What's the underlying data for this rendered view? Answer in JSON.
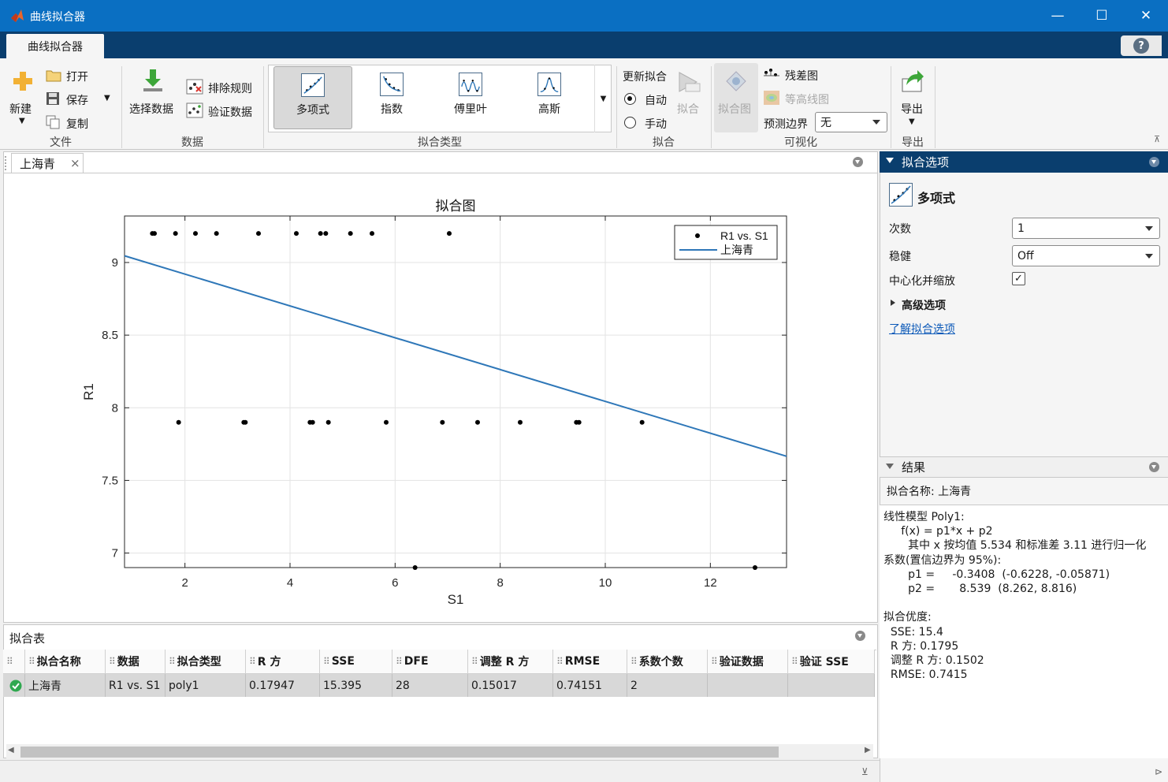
{
  "window": {
    "title": "曲线拟合器",
    "min": "—",
    "max": "☐",
    "close": "✕"
  },
  "app_tab": "曲线拟合器",
  "help": "?",
  "ribbon": {
    "file": {
      "new": "新建",
      "open": "打开",
      "save": "保存",
      "copy": "复制",
      "group": "文件"
    },
    "data": {
      "select": "选择数据",
      "exclusion": "排除规则",
      "validation": "验证数据",
      "group": "数据"
    },
    "fit_type": {
      "items": [
        "多项式",
        "指数",
        "傅里叶",
        "高斯"
      ],
      "group": "拟合类型"
    },
    "fit": {
      "update": "更新拟合",
      "auto": "自动",
      "manual": "手动",
      "fit_btn": "拟合",
      "group": "拟合"
    },
    "viz": {
      "fit_plot": "拟合图",
      "residuals": "残差图",
      "contour": "等高线图",
      "pred_bounds": "预测边界",
      "pred_value": "无",
      "group": "可视化"
    },
    "export": {
      "label": "导出",
      "group": "导出"
    }
  },
  "doc_tab": "上海青",
  "doc_tab_close": "×",
  "chart_data": {
    "type": "scatter",
    "title": "拟合图",
    "xlabel": "S1",
    "ylabel": "R1",
    "xlim": [
      0.85,
      13.45
    ],
    "ylim": [
      6.9,
      9.32
    ],
    "xticks": [
      2,
      4,
      6,
      8,
      10,
      12
    ],
    "yticks": [
      7,
      7.5,
      8,
      8.5,
      9
    ],
    "ytick_labels": [
      "7",
      "7.5",
      "8",
      "8.5",
      "9"
    ],
    "grid": true,
    "legend_position": "top-right",
    "series": [
      {
        "name": "R1 vs. S1",
        "style": "points",
        "color": "#000000",
        "x": [
          1.38,
          1.42,
          1.82,
          2.2,
          2.6,
          3.4,
          4.12,
          4.58,
          4.68,
          5.15,
          5.56,
          7.03,
          1.88,
          3.12,
          3.15,
          4.38,
          4.43,
          4.73,
          5.83,
          6.9,
          7.57,
          8.38,
          9.45,
          9.5,
          10.7,
          6.38,
          12.85
        ],
        "y": [
          9.2,
          9.2,
          9.2,
          9.2,
          9.2,
          9.2,
          9.2,
          9.2,
          9.2,
          9.2,
          9.2,
          9.2,
          7.9,
          7.9,
          7.9,
          7.9,
          7.9,
          7.9,
          7.9,
          7.9,
          7.9,
          7.9,
          7.9,
          7.9,
          7.9,
          6.9,
          6.9
        ]
      },
      {
        "name": "上海青",
        "style": "line",
        "color": "#2e77b8",
        "x": [
          0.85,
          13.45
        ],
        "y": [
          9.046,
          7.666
        ]
      }
    ]
  },
  "fit_table": {
    "title": "拟合表",
    "columns": [
      "拟合名称",
      "数据",
      "拟合类型",
      "R 方",
      "SSE",
      "DFE",
      "调整 R 方",
      "RMSE",
      "系数个数",
      "验证数据",
      "验证 SSE"
    ],
    "row": [
      "上海青",
      "R1 vs. S1",
      "poly1",
      "0.17947",
      "15.395",
      "28",
      "0.15017",
      "0.74151",
      "2",
      "",
      ""
    ]
  },
  "fit_options": {
    "header": "拟合选项",
    "model": "多项式",
    "degree_label": "次数",
    "degree": "1",
    "robust_label": "稳健",
    "robust": "Off",
    "center_label": "中心化并缩放",
    "center_checked": "✓",
    "advanced": "高级选项",
    "learn_more": "了解拟合选项"
  },
  "results": {
    "header": "结果",
    "fit_name": "拟合名称: 上海青",
    "lines": [
      "线性模型 Poly1:",
      "     f(x) = p1*x + p2",
      "       其中 x 按均值 5.534 和标准差 3.11 进行归一化",
      "系数(置信边界为 95%):",
      "       p1 =     -0.3408  (-0.6228, -0.05871)",
      "       p2 =       8.539  (8.262, 8.816)",
      "",
      "拟合优度:",
      "  SSE: 15.4",
      "  R 方: 0.1795",
      "  调整 R 方: 0.1502",
      "  RMSE: 0.7415"
    ]
  },
  "colors": {
    "titlebar": "#0a6fc2",
    "tabstrip": "#0a3e6e",
    "fit_line": "#2e77b8",
    "link": "#0a58b8"
  }
}
